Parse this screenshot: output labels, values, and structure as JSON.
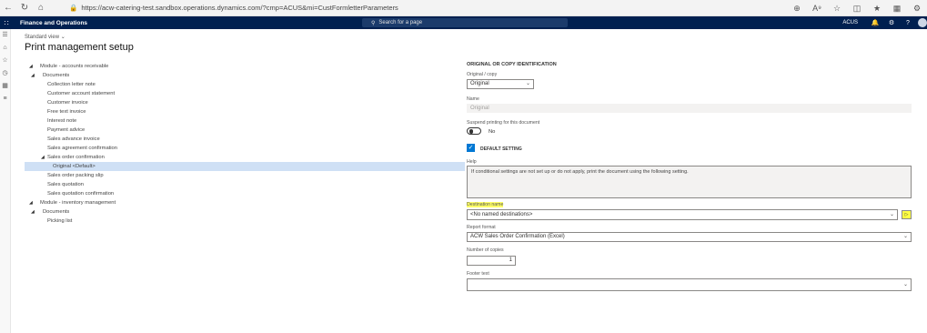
{
  "browser": {
    "url": "https://acw-catering-test.sandbox.operations.dynamics.com/?cmp=ACUS&mi=CustFormletterParameters",
    "icons": [
      "back-icon",
      "refresh-icon",
      "home-icon",
      "lock-icon",
      "zoom-icon",
      "read-aloud-icon",
      "favorite-icon",
      "split-screen-icon",
      "favorites-bar-icon",
      "collections-icon",
      "extensions-icon"
    ]
  },
  "app": {
    "name": "Finance and Operations",
    "search_placeholder": "Search for a page",
    "company": "ACUS",
    "help_glyph": "?"
  },
  "page": {
    "view": "Standard view",
    "title": "Print management setup"
  },
  "tree": [
    {
      "label": "Module - accounts receivable",
      "level": 0,
      "expanded": true
    },
    {
      "label": "Documents",
      "level": 1,
      "expanded": true
    },
    {
      "label": "Collection letter note",
      "level": 2
    },
    {
      "label": "Customer account statement",
      "level": 2
    },
    {
      "label": "Customer invoice",
      "level": 2
    },
    {
      "label": "Free text invoice",
      "level": 2
    },
    {
      "label": "Interest note",
      "level": 2
    },
    {
      "label": "Payment advice",
      "level": 2
    },
    {
      "label": "Sales advance invoice",
      "level": 2
    },
    {
      "label": "Sales agreement confirmation",
      "level": 2
    },
    {
      "label": "Sales order confirmation",
      "level": 2,
      "expanded": true
    },
    {
      "label": "Original <Default>",
      "level": 3,
      "selected": true
    },
    {
      "label": "Sales order packing slip",
      "level": 2
    },
    {
      "label": "Sales quotation",
      "level": 2
    },
    {
      "label": "Sales quotation confirmation",
      "level": 2
    },
    {
      "label": "Module - inventory management",
      "level": 0,
      "expanded": true
    },
    {
      "label": "Documents",
      "level": 1,
      "expanded": true
    },
    {
      "label": "Picking list",
      "level": 2
    }
  ],
  "panel": {
    "section_title": "ORIGINAL OR COPY IDENTIFICATION",
    "original_copy_label": "Original / copy",
    "original_copy_value": "Original",
    "name_label": "Name",
    "name_value": "Original",
    "suspend_label": "Suspend printing for this document",
    "suspend_value": "No",
    "default_setting_label": "DEFAULT SETTING",
    "help_label": "Help",
    "help_text": "If conditional settings are not set up or do not apply, print the document using the following setting.",
    "destination_label": "Destination name",
    "destination_value": "<No named destinations>",
    "report_format_label": "Report format",
    "report_format_value": "ACW Sales Order Confirmation (Excel)",
    "copies_label": "Number of copies",
    "copies_value": "1",
    "footer_label": "Footer text",
    "footer_value": ""
  },
  "colors": {
    "app_bar": "#002050",
    "selection": "#cfe0f5",
    "accent": "#0078d4",
    "highlight": "#ffff66"
  }
}
